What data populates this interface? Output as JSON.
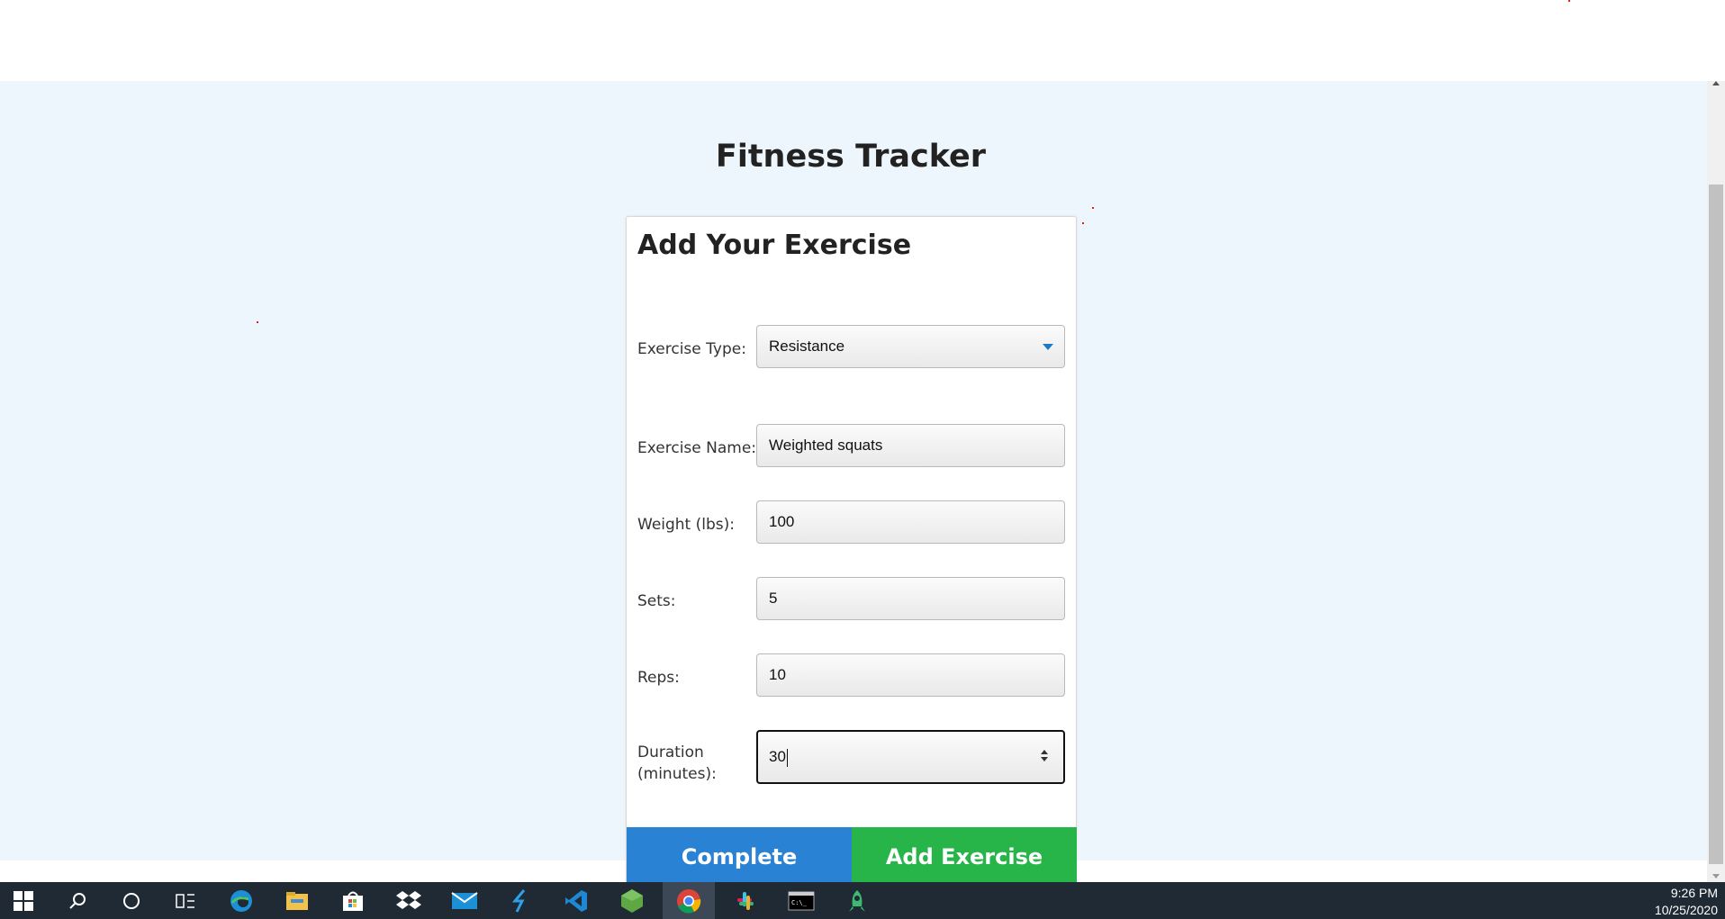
{
  "page": {
    "title": "Fitness Tracker"
  },
  "card": {
    "title": "Add Your Exercise",
    "fields": [
      {
        "label": "Exercise Type:",
        "value": "Resistance"
      },
      {
        "label": "Exercise Name:",
        "value": "Weighted squats"
      },
      {
        "label": "Weight (lbs):",
        "value": "100"
      },
      {
        "label": "Sets:",
        "value": "5"
      },
      {
        "label": "Reps:",
        "value": "10"
      },
      {
        "label_line1": "Duration",
        "label_line2": "(minutes):",
        "value": "30"
      }
    ],
    "buttons": {
      "complete": "Complete",
      "add": "Add Exercise"
    }
  },
  "taskbar": {
    "icons": [
      "windows-start-icon",
      "search-icon",
      "cortana-icon",
      "task-view-icon",
      "edge-icon",
      "file-explorer-icon",
      "store-icon",
      "dropbox-icon",
      "mail-icon",
      "visual-studio-icon",
      "vscode-icon",
      "node-icon",
      "chrome-icon",
      "slack-icon",
      "terminal-icon",
      "rocket-app-icon"
    ],
    "time": "9:26 PM",
    "date": "10/25/2020"
  },
  "colors": {
    "complete": "#2a82d4",
    "add": "#27b54a",
    "page_bg": "#eef6fd",
    "taskbar": "#1f2a35"
  }
}
